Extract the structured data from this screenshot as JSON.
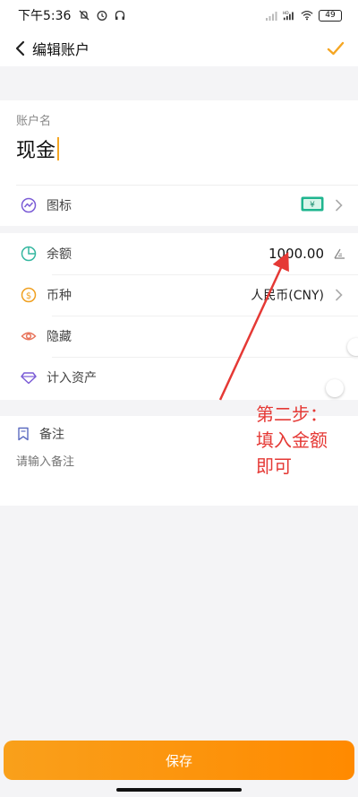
{
  "status_bar": {
    "time": "下午5:36",
    "battery": "49",
    "icons": [
      "mute-icon",
      "alarm-icon",
      "headphones-icon",
      "signal-icon",
      "hd-signal-icon",
      "wifi-icon",
      "battery-icon"
    ]
  },
  "header": {
    "title": "编辑账户",
    "back_icon": "chevron-left-icon",
    "confirm_icon": "checkmark-icon"
  },
  "account_name": {
    "label": "账户名",
    "value": "现金"
  },
  "icon_row": {
    "label": "图标",
    "preview_icon": "banknote-icon",
    "preview_symbol": "¥"
  },
  "balance_row": {
    "label": "余额",
    "value": "1000.00",
    "edit_icon": "ruler-pencil-icon"
  },
  "currency_row": {
    "label": "币种",
    "value": "人民币(CNY)"
  },
  "hidden_row": {
    "label": "隐藏",
    "enabled": false
  },
  "assets_row": {
    "label": "计入资产",
    "enabled": true
  },
  "note": {
    "label": "备注",
    "placeholder": "请输入备注"
  },
  "annotation": {
    "line1": "第二步：",
    "line2": "填入金额",
    "line3": "即可"
  },
  "save_button": {
    "label": "保存"
  },
  "colors": {
    "accent": "#f5a623",
    "annotation": "#e53935",
    "background": "#f4f4f6"
  }
}
